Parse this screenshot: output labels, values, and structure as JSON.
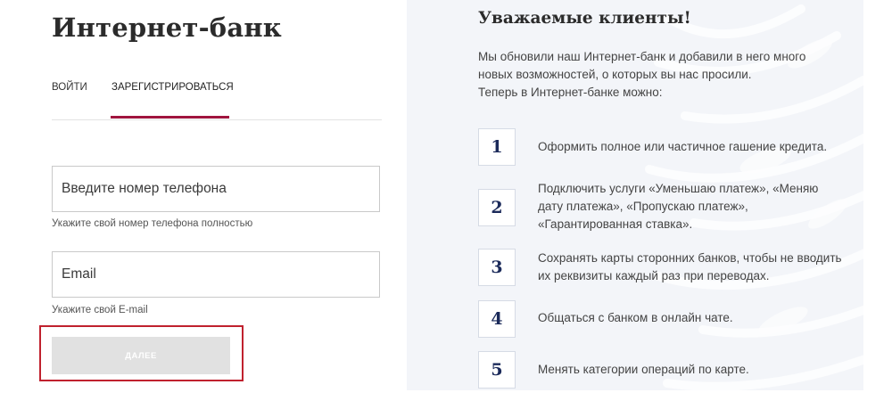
{
  "login": {
    "title": "Интернет-банк",
    "tabs": {
      "login": "ВОЙТИ",
      "register": "ЗАРЕГИСТРИРОВАТЬСЯ"
    },
    "phone": {
      "placeholder": "Введите номер телефона",
      "hint": "Укажите свой номер телефона полностью"
    },
    "email": {
      "placeholder": "Email",
      "hint": "Укажите свой E-mail"
    },
    "next_button": "ДАЛЕЕ"
  },
  "notice": {
    "title": "Уважаемые клиенты!",
    "intro": [
      "Мы обновили наш Интернет-банк и добавили в него много",
      "новых возможностей, о которых вы нас просили.",
      "Теперь в Интернет-банке можно:"
    ],
    "features": [
      {
        "number": "1",
        "lines": [
          "Оформить полное или частичное гашение кредита."
        ]
      },
      {
        "number": "2",
        "lines": [
          "Подключить услуги «Уменьшаю платеж», «Меняю",
          "дату платежа», «Пропускаю платеж»,",
          "«Гарантированная ставка»."
        ]
      },
      {
        "number": "3",
        "lines": [
          "Сохранять карты сторонних банков, чтобы не вводить",
          "их реквизиты каждый раз при переводах."
        ]
      },
      {
        "number": "4",
        "lines": [
          "Общаться с банком в онлайн чате."
        ]
      },
      {
        "number": "5",
        "lines": [
          "Менять категории операций по карте."
        ]
      }
    ]
  },
  "colors": {
    "accent": "#a0153e",
    "highlight": "#c0212e",
    "number_text": "#1b2a5a",
    "panel_bg": "#f3f5f9",
    "button_disabled": "#e1e1e1"
  }
}
